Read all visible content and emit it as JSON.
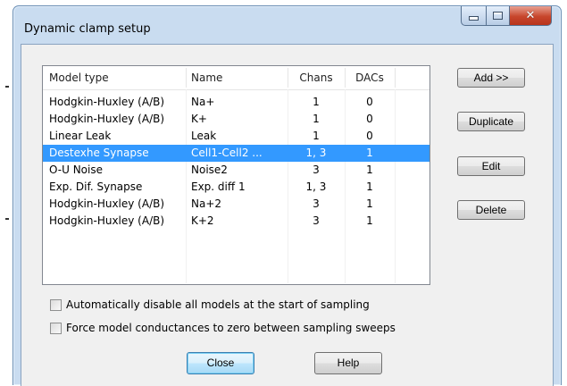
{
  "window": {
    "title": "Dynamic clamp setup",
    "caption": {
      "minimize": "–",
      "maximize": "□",
      "close": "✕"
    }
  },
  "list": {
    "headers": [
      "Model type",
      "Name",
      "Chans",
      "DACs"
    ],
    "rows": [
      [
        "Hodgkin-Huxley (A/B)",
        "Na+",
        "1",
        "0"
      ],
      [
        "Hodgkin-Huxley (A/B)",
        "K+",
        "1",
        "0"
      ],
      [
        "Linear Leak",
        "Leak",
        "1",
        "0"
      ],
      [
        "Destexhe Synapse",
        "Cell1-Cell2 ...",
        "1, 3",
        "1"
      ],
      [
        "O-U Noise",
        "Noise2",
        "3",
        "1"
      ],
      [
        "Exp. Dif. Synapse",
        "Exp. diff 1",
        "1, 3",
        "1"
      ],
      [
        "Hodgkin-Huxley (A/B)",
        "Na+2",
        "3",
        "1"
      ],
      [
        "Hodgkin-Huxley (A/B)",
        "K+2",
        "3",
        "1"
      ]
    ],
    "selected_row": 3
  },
  "buttons": {
    "add": "Add >>",
    "duplicate": "Duplicate",
    "edit": "Edit",
    "delete": "Delete",
    "close": "Close",
    "help": "Help"
  },
  "options": {
    "auto_disable": {
      "label": "Automatically disable all models at the start of sampling",
      "checked": false
    },
    "force_zero": {
      "label": "Force model conductances to zero between sampling sweeps",
      "checked": false
    }
  },
  "colors": {
    "selection": "#3399ff",
    "window_frame": "#c9dcf0",
    "close_button": "#c7462c"
  }
}
